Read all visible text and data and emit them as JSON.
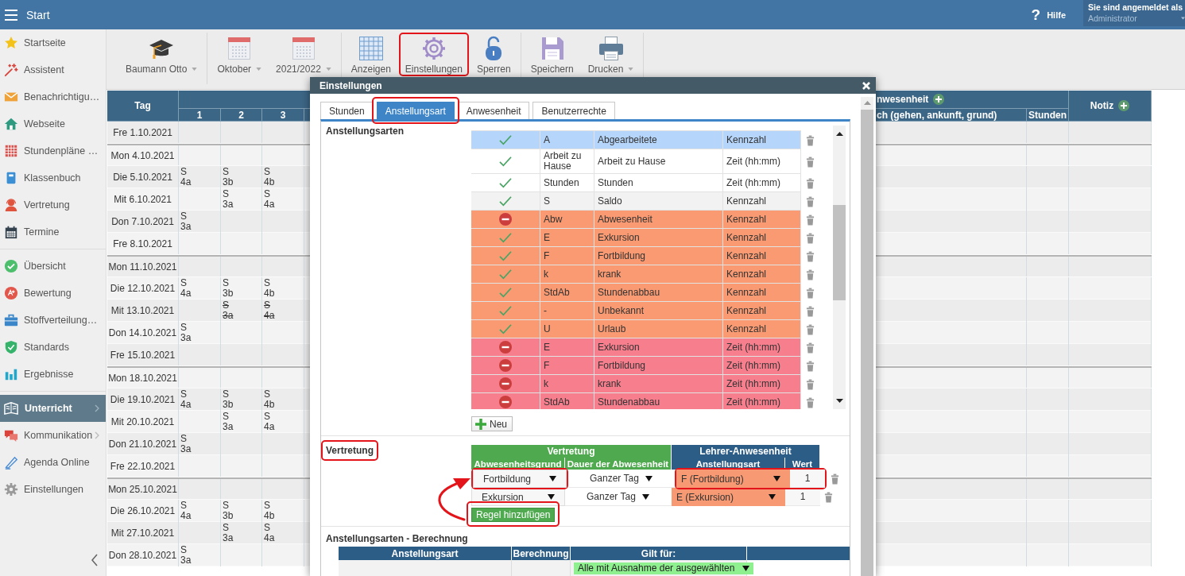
{
  "topbar": {
    "title": "Start",
    "help_icon": "?",
    "help": "Hilfe",
    "user_caption": "Sie sind angemeldet als",
    "user_name": "Administrator"
  },
  "sidebar": {
    "groups": [
      {
        "items": [
          {
            "label": "Startseite",
            "selected": false,
            "expandable": false
          },
          {
            "label": "Assistent",
            "selected": false,
            "expandable": false
          },
          {
            "label": "Benachrichtigu…",
            "selected": false,
            "expandable": false
          },
          {
            "label": "Webseite",
            "selected": false,
            "expandable": false
          },
          {
            "label": "Stundenpläne …",
            "selected": false,
            "expandable": false
          },
          {
            "label": "Klassenbuch",
            "selected": false,
            "expandable": false
          },
          {
            "label": "Vertretung",
            "selected": false,
            "expandable": false
          },
          {
            "label": "Termine",
            "selected": false,
            "expandable": false
          }
        ]
      },
      {
        "items": [
          {
            "label": "Übersicht",
            "selected": false,
            "expandable": false
          },
          {
            "label": "Bewertung",
            "selected": false,
            "expandable": false
          },
          {
            "label": "Stoffverteilung…",
            "selected": false,
            "expandable": false
          },
          {
            "label": "Standards",
            "selected": false,
            "expandable": false
          },
          {
            "label": "Ergebnisse",
            "selected": false,
            "expandable": false
          }
        ]
      },
      {
        "items": [
          {
            "label": "Unterricht",
            "selected": true,
            "expandable": true
          },
          {
            "label": "Kommunikation",
            "selected": false,
            "expandable": true
          },
          {
            "label": "Agenda Online",
            "selected": false,
            "expandable": false
          },
          {
            "label": "Einstellungen",
            "selected": false,
            "expandable": false
          }
        ]
      }
    ]
  },
  "toolbar": {
    "groups": [
      {
        "items": [
          {
            "label": "Baumann Otto",
            "dropdown": true,
            "annotated": false
          }
        ]
      },
      {
        "items": [
          {
            "label": "Oktober",
            "dropdown": true,
            "annotated": false
          },
          {
            "label": "2021/2022",
            "dropdown": true,
            "annotated": false
          }
        ]
      },
      {
        "items": [
          {
            "label": "Anzeigen",
            "dropdown": false,
            "annotated": false
          },
          {
            "label": "Einstellungen",
            "dropdown": false,
            "annotated": true
          },
          {
            "label": "Sperren",
            "dropdown": false,
            "annotated": false
          }
        ]
      },
      {
        "items": [
          {
            "label": "Speichern",
            "dropdown": false,
            "annotated": false
          },
          {
            "label": "Drucken",
            "dropdown": true,
            "annotated": false
          }
        ]
      }
    ]
  },
  "timetable": {
    "header": {
      "day": "Tag",
      "periods": [
        "1",
        "2",
        "3"
      ],
      "attendance": "nwesenheit",
      "attendance_columns": [
        "ch (gehen, ankunft, grund)",
        "Stunden"
      ],
      "note": "Notiz"
    },
    "rows": [
      {
        "day": "Fre 1.10.2021",
        "week_start": false,
        "cells": [
          {
            "kind": "empty"
          },
          {
            "kind": "empty"
          },
          {
            "kind": "empty"
          }
        ]
      },
      {
        "day": "Mon 4.10.2021",
        "week_start": true,
        "cells": [
          {
            "kind": "empty"
          },
          {
            "kind": "empty"
          },
          {
            "kind": "empty"
          }
        ]
      },
      {
        "day": "Die 5.10.2021",
        "week_start": false,
        "cells": [
          {
            "kind": "lesson",
            "subject": "S",
            "class": "4a",
            "cancelled": false
          },
          {
            "kind": "lesson",
            "subject": "S",
            "class": "3b",
            "cancelled": false
          },
          {
            "kind": "lesson",
            "subject": "S",
            "class": "4b",
            "cancelled": false
          }
        ]
      },
      {
        "day": "Mit 6.10.2021",
        "week_start": false,
        "cells": [
          {
            "kind": "empty"
          },
          {
            "kind": "lesson",
            "subject": "S",
            "class": "3a",
            "cancelled": false
          },
          {
            "kind": "lesson",
            "subject": "S",
            "class": "4a",
            "cancelled": false
          }
        ]
      },
      {
        "day": "Don 7.10.2021",
        "week_start": false,
        "cells": [
          {
            "kind": "lesson",
            "subject": "S",
            "class": "3a",
            "cancelled": false
          },
          {
            "kind": "empty"
          },
          {
            "kind": "empty"
          }
        ]
      },
      {
        "day": "Fre 8.10.2021",
        "week_start": false,
        "cells": [
          {
            "kind": "empty"
          },
          {
            "kind": "empty"
          },
          {
            "kind": "empty"
          }
        ]
      },
      {
        "day": "Mon 11.10.2021",
        "week_start": true,
        "cells": [
          {
            "kind": "empty"
          },
          {
            "kind": "empty"
          },
          {
            "kind": "empty"
          }
        ]
      },
      {
        "day": "Die 12.10.2021",
        "week_start": false,
        "cells": [
          {
            "kind": "lesson",
            "subject": "S",
            "class": "4a",
            "cancelled": false
          },
          {
            "kind": "lesson",
            "subject": "S",
            "class": "3b",
            "cancelled": false
          },
          {
            "kind": "lesson",
            "subject": "S",
            "class": "4b",
            "cancelled": false
          }
        ]
      },
      {
        "day": "Mit 13.10.2021",
        "week_start": false,
        "cells": [
          {
            "kind": "empty"
          },
          {
            "kind": "lesson",
            "subject": "S",
            "class": "3a",
            "cancelled": true
          },
          {
            "kind": "lesson",
            "subject": "S",
            "class": "4a",
            "cancelled": true
          }
        ]
      },
      {
        "day": "Don 14.10.2021",
        "week_start": false,
        "cells": [
          {
            "kind": "lesson",
            "subject": "S",
            "class": "3a",
            "cancelled": false
          },
          {
            "kind": "empty"
          },
          {
            "kind": "empty"
          }
        ]
      },
      {
        "day": "Fre 15.10.2021",
        "week_start": false,
        "cells": [
          {
            "kind": "empty"
          },
          {
            "kind": "empty"
          },
          {
            "kind": "empty"
          }
        ]
      },
      {
        "day": "Mon 18.10.2021",
        "week_start": true,
        "cells": [
          {
            "kind": "empty"
          },
          {
            "kind": "empty"
          },
          {
            "kind": "empty"
          }
        ]
      },
      {
        "day": "Die 19.10.2021",
        "week_start": false,
        "cells": [
          {
            "kind": "lesson",
            "subject": "S",
            "class": "4a",
            "cancelled": false
          },
          {
            "kind": "lesson",
            "subject": "S",
            "class": "3b",
            "cancelled": false
          },
          {
            "kind": "lesson",
            "subject": "S",
            "class": "4b",
            "cancelled": false
          }
        ]
      },
      {
        "day": "Mit 20.10.2021",
        "week_start": false,
        "cells": [
          {
            "kind": "empty"
          },
          {
            "kind": "lesson",
            "subject": "S",
            "class": "3a",
            "cancelled": false
          },
          {
            "kind": "lesson",
            "subject": "S",
            "class": "4a",
            "cancelled": false
          }
        ]
      },
      {
        "day": "Don 21.10.2021",
        "week_start": false,
        "cells": [
          {
            "kind": "lesson",
            "subject": "S",
            "class": "3a",
            "cancelled": false
          },
          {
            "kind": "empty"
          },
          {
            "kind": "empty"
          }
        ]
      },
      {
        "day": "Fre 22.10.2021",
        "week_start": false,
        "cells": [
          {
            "kind": "empty"
          },
          {
            "kind": "empty"
          },
          {
            "kind": "empty"
          }
        ]
      },
      {
        "day": "Mon 25.10.2021",
        "week_start": true,
        "cells": [
          {
            "kind": "empty"
          },
          {
            "kind": "empty"
          },
          {
            "kind": "empty"
          }
        ]
      },
      {
        "day": "Die 26.10.2021",
        "week_start": false,
        "cells": [
          {
            "kind": "lesson",
            "subject": "S",
            "class": "4a",
            "cancelled": false
          },
          {
            "kind": "lesson",
            "subject": "S",
            "class": "3b",
            "cancelled": false
          },
          {
            "kind": "lesson",
            "subject": "S",
            "class": "4b",
            "cancelled": false
          }
        ]
      },
      {
        "day": "Mit 27.10.2021",
        "week_start": false,
        "cells": [
          {
            "kind": "empty"
          },
          {
            "kind": "lesson",
            "subject": "S",
            "class": "3a",
            "cancelled": false
          },
          {
            "kind": "lesson",
            "subject": "S",
            "class": "4a",
            "cancelled": false
          }
        ]
      },
      {
        "day": "Don 28.10.2021",
        "week_start": false,
        "cells": [
          {
            "kind": "lesson",
            "subject": "S",
            "class": "3a",
            "cancelled": false
          },
          {
            "kind": "empty"
          },
          {
            "kind": "empty"
          }
        ]
      }
    ]
  },
  "dialog": {
    "title": "Einstellungen",
    "tabs": [
      {
        "label": "Stunden",
        "selected": false,
        "annotated": false
      },
      {
        "label": "Anstellungsart",
        "selected": true,
        "annotated": true
      },
      {
        "label": "Anwesenheit",
        "selected": false,
        "annotated": false
      },
      {
        "label": "Benutzerrechte",
        "selected": false,
        "annotated": false
      }
    ],
    "employment_types": {
      "label": "Anstellungsarten",
      "new_button": "Neu",
      "rows": [
        {
          "active": true,
          "code": "A",
          "name": "Abgearbeitete",
          "unit": "Kennzahl",
          "selected": true
        },
        {
          "active": true,
          "code": "Arbeit zu Hause",
          "name": "Arbeit zu Hause",
          "unit": "Zeit (hh:mm)",
          "selected": false,
          "color": "#ffffff"
        },
        {
          "active": true,
          "code": "Stunden",
          "name": "Stunden",
          "unit": "Zeit (hh:mm)",
          "selected": false,
          "color": "#ffffff"
        },
        {
          "active": true,
          "code": "S",
          "name": "Saldo",
          "unit": "Kennzahl",
          "selected": false,
          "color": "#f2f2f2"
        },
        {
          "active": false,
          "code": "Abw",
          "name": "Abwesenheit",
          "unit": "Kennzahl",
          "selected": false,
          "color": "#f99a72"
        },
        {
          "active": true,
          "code": "E",
          "name": "Exkursion",
          "unit": "Kennzahl",
          "selected": false,
          "color": "#f99a72"
        },
        {
          "active": true,
          "code": "F",
          "name": "Fortbildung",
          "unit": "Kennzahl",
          "selected": false,
          "color": "#f99a72"
        },
        {
          "active": true,
          "code": "k",
          "name": "krank",
          "unit": "Kennzahl",
          "selected": false,
          "color": "#f99a72"
        },
        {
          "active": true,
          "code": "StdAb",
          "name": "Stundenabbau",
          "unit": "Kennzahl",
          "selected": false,
          "color": "#f99a72"
        },
        {
          "active": true,
          "code": "-",
          "name": "Unbekannt",
          "unit": "Kennzahl",
          "selected": false,
          "color": "#f99a72"
        },
        {
          "active": true,
          "code": "U",
          "name": "Urlaub",
          "unit": "Kennzahl",
          "selected": false,
          "color": "#f99a72"
        },
        {
          "active": false,
          "code": "E",
          "name": "Exkursion",
          "unit": "Zeit (hh:mm)",
          "selected": false,
          "color": "#f77e8d"
        },
        {
          "active": false,
          "code": "F",
          "name": "Fortbildung",
          "unit": "Zeit (hh:mm)",
          "selected": false,
          "color": "#f77e8d"
        },
        {
          "active": false,
          "code": "k",
          "name": "krank",
          "unit": "Zeit (hh:mm)",
          "selected": false,
          "color": "#f77e8d"
        },
        {
          "active": false,
          "code": "StdAb",
          "name": "Stundenabbau",
          "unit": "Zeit (hh:mm)",
          "selected": false,
          "color": "#f77e8d"
        }
      ]
    },
    "substitution": {
      "label": "Vertretung",
      "annotated": true,
      "group_headers": [
        "Vertretung",
        "Lehrer-Anwesenheit"
      ],
      "columns": [
        "Abwesenheitsgrund",
        "Dauer der Abwesenheit",
        "Anstellungsart",
        "Wert"
      ],
      "rules": [
        {
          "reason": "Fortbildung",
          "reason_annotated": true,
          "duration": "Ganzer Tag",
          "employment_type": "F (Fortbildung)",
          "value": "1",
          "target_annotated": true
        },
        {
          "reason": "Exkursion",
          "reason_annotated": false,
          "duration": "Ganzer Tag",
          "employment_type": "E (Exkursion)",
          "value": "1",
          "target_annotated": false
        }
      ],
      "add_button": "Regel hinzufügen",
      "add_annotated": true
    },
    "calculation": {
      "label": "Anstellungsarten - Berechnung",
      "columns": [
        "Anstellungsart",
        "Berechnung",
        "Gilt für:"
      ],
      "rows": [
        {
          "applies_to": "Alle mit Ausnahme der ausgewählten"
        }
      ]
    }
  }
}
